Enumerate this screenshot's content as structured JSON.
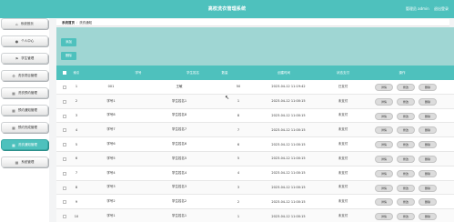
{
  "header": {
    "title": "高校洗衣管理系统",
    "user_label": "管理员 admin",
    "logout_label": "退出登录"
  },
  "sidebar": {
    "items": [
      {
        "label": "系统首页",
        "icon": "home-icon",
        "glyph": "⌂"
      },
      {
        "label": "个人中心",
        "icon": "user-icon",
        "glyph": "👤"
      },
      {
        "label": "学生管理",
        "icon": "flag-icon",
        "glyph": "⚑"
      },
      {
        "label": "洗衣项目管理",
        "icon": "gear-icon",
        "glyph": "⚙"
      },
      {
        "label": "洗衣预约管理",
        "icon": "grid-icon",
        "glyph": "▦"
      },
      {
        "label": "预约通知管理",
        "icon": "grid-icon",
        "glyph": "▦"
      },
      {
        "label": "预约完成管理",
        "icon": "grid-icon",
        "glyph": "▦"
      },
      {
        "label": "洗衣通知管理",
        "icon": "grid-icon",
        "glyph": "▦"
      },
      {
        "label": "系统管理",
        "icon": "grid-icon",
        "glyph": "▦"
      },
      {
        "label": "系统管理",
        "icon": "grid-icon",
        "glyph": "▦"
      }
    ]
  },
  "breadcrumb": {
    "home": "系统首页",
    "current": "洗衣通知"
  },
  "toolbar": {
    "add_label": "添加",
    "delete_label": "删除"
  },
  "table": {
    "headers": {
      "idx": "索引",
      "name": "学号",
      "obj": "学生姓名",
      "qty": "数量",
      "time": "创建时间",
      "status": "状态支付",
      "op": "操作"
    },
    "rows": [
      {
        "idx": "1",
        "name": "001",
        "obj": "王敏",
        "qty": "50",
        "time": "2023-04-12 11:19:42",
        "status": "已支付"
      },
      {
        "idx": "2",
        "name": "学号1",
        "obj": "学生姓名1",
        "qty": "1",
        "time": "2023-04-12 11:00:15",
        "status": "未支付"
      },
      {
        "idx": "3",
        "name": "学号8",
        "obj": "学生姓名8",
        "qty": "8",
        "time": "2023-04-12 11:00:15",
        "status": "未支付"
      },
      {
        "idx": "4",
        "name": "学号7",
        "obj": "学生姓名7",
        "qty": "7",
        "time": "2023-04-12 11:00:15",
        "status": "未支付"
      },
      {
        "idx": "5",
        "name": "学号6",
        "obj": "学生姓名6",
        "qty": "6",
        "time": "2023-04-12 11:00:15",
        "status": "未支付"
      },
      {
        "idx": "6",
        "name": "学号5",
        "obj": "学生姓名5",
        "qty": "5",
        "time": "2023-04-12 11:00:15",
        "status": "未支付"
      },
      {
        "idx": "7",
        "name": "学号4",
        "obj": "学生姓名4",
        "qty": "4",
        "time": "2023-04-12 11:00:15",
        "status": "未支付"
      },
      {
        "idx": "8",
        "name": "学号3",
        "obj": "学生姓名3",
        "qty": "3",
        "time": "2023-04-12 11:00:15",
        "status": "未支付"
      },
      {
        "idx": "9",
        "name": "学号2",
        "obj": "学生姓名2",
        "qty": "2",
        "time": "2023-04-12 11:00:15",
        "status": "未支付"
      },
      {
        "idx": "10",
        "name": "学号1",
        "obj": "学生姓名1",
        "qty": "1",
        "time": "2023-04-12 11:00:15",
        "status": "未支付"
      }
    ],
    "actions": {
      "detail": "详情",
      "edit": "修改",
      "delete": "删除"
    }
  },
  "colors": {
    "accent": "#4ec1bd",
    "panel": "#9fd6d3"
  }
}
